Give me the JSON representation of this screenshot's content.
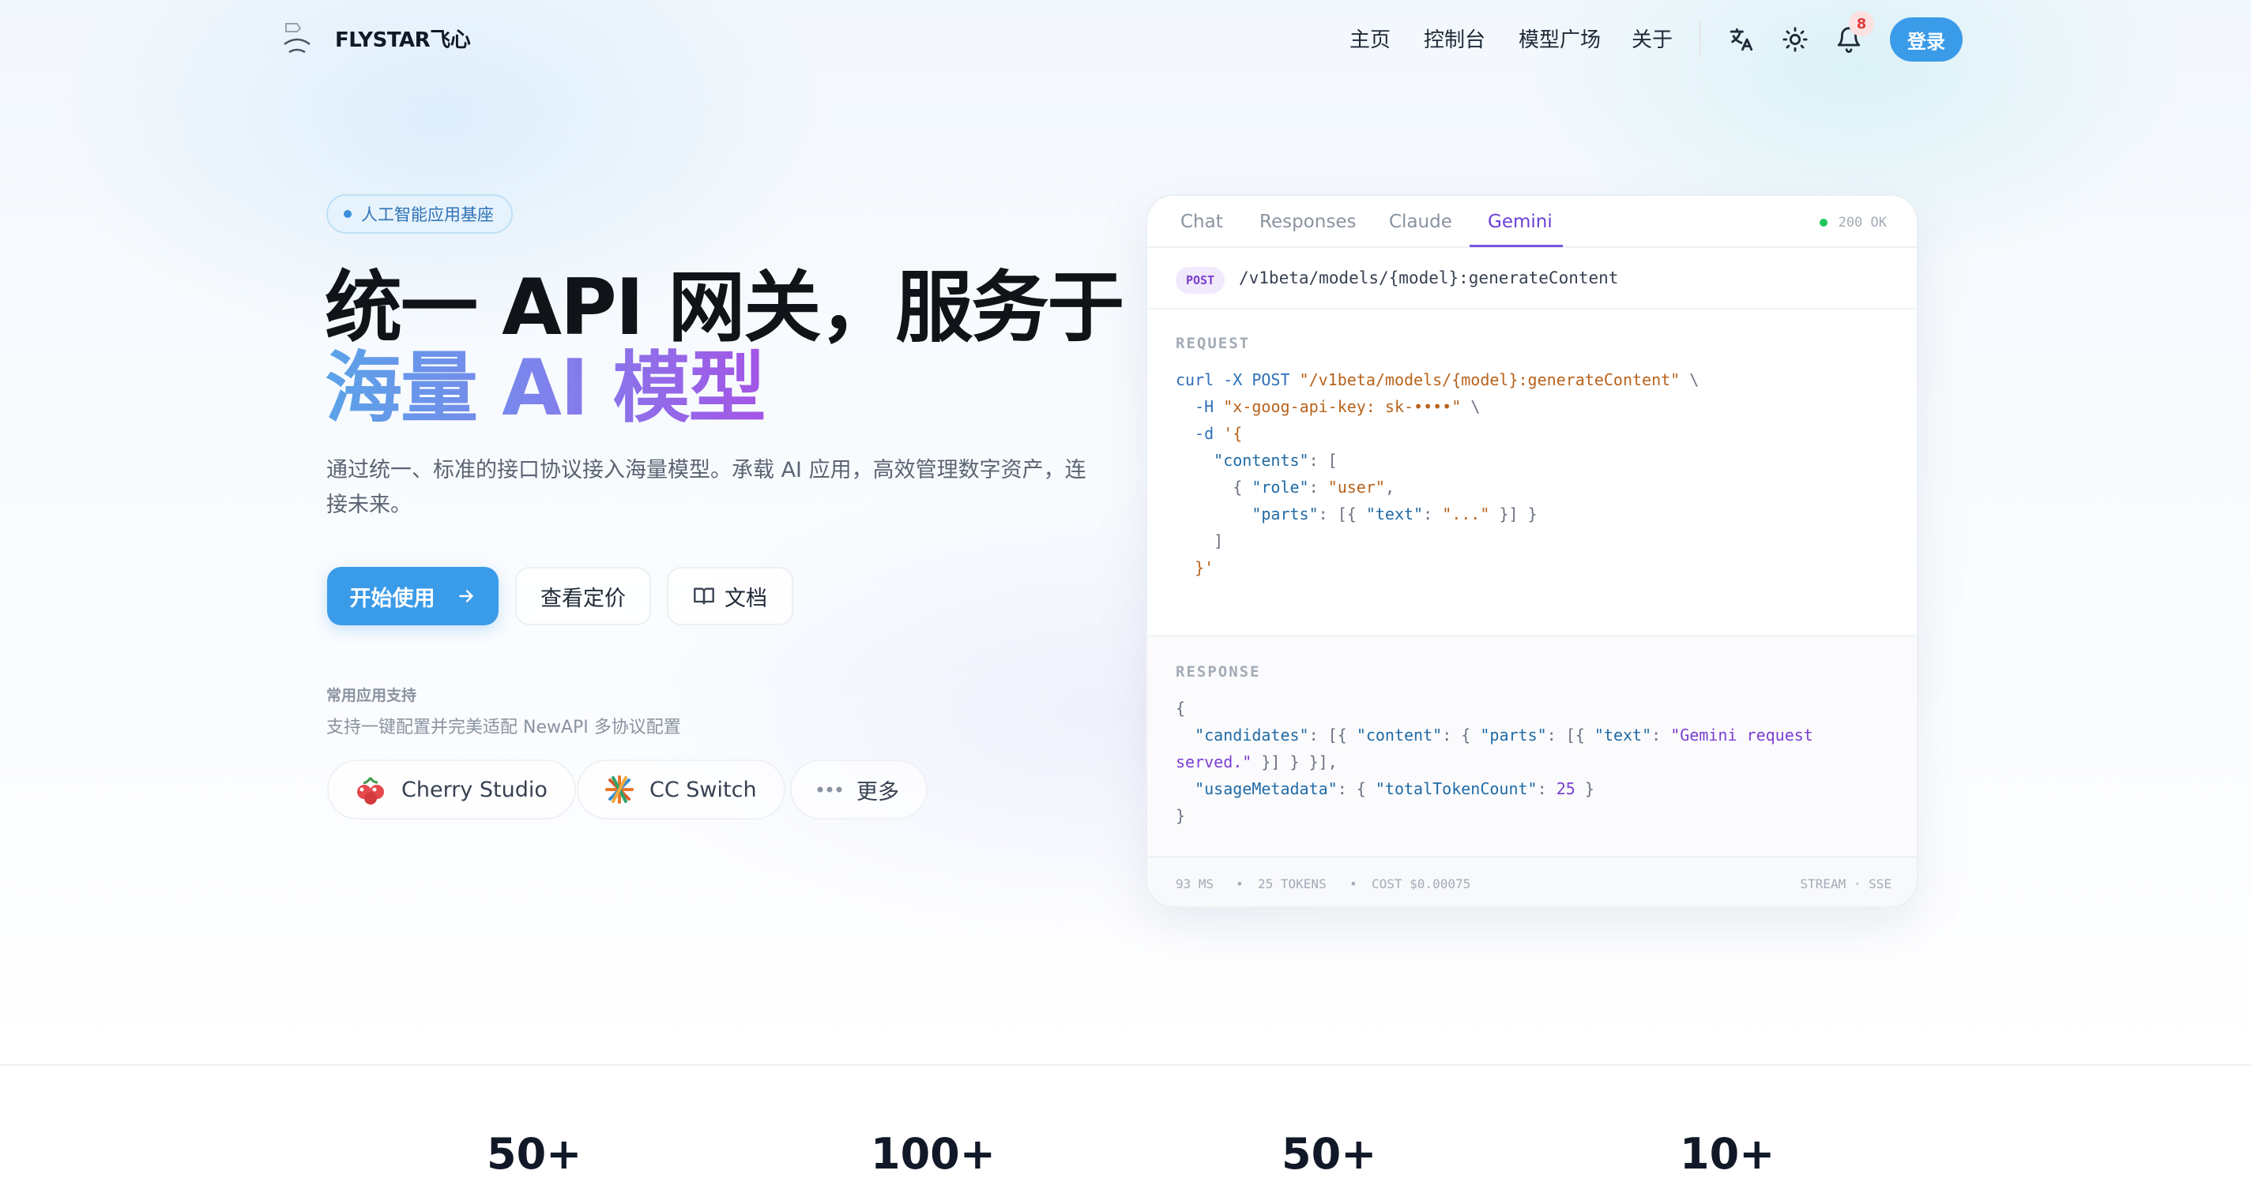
{
  "nav": {
    "brand": "FLYSTAR飞心",
    "links": [
      "主页",
      "控制台",
      "模型广场",
      "关于"
    ],
    "notification_count": "8",
    "login_label": "登录",
    "icons": [
      "translate-icon",
      "sun-icon",
      "bell-icon"
    ]
  },
  "hero": {
    "tag": "人工智能应用基座",
    "title_line1": "统一 API 网关，服务于",
    "title_line2": "海量 AI 模型",
    "subtitle": "通过统一、标准的接口协议接入海量模型。承载 AI 应用，高效管理数字资产，连接未来。",
    "primary_button": "开始使用",
    "pricing_button": "查看定价",
    "docs_button": "文档",
    "support_title": "常用应用支持",
    "support_subtitle": "支持一键配置并完美适配 NewAPI 多协议配置",
    "apps": [
      "Cherry Studio",
      "CC Switch",
      "更多"
    ]
  },
  "code_card": {
    "tabs": [
      "Chat",
      "Responses",
      "Claude",
      "Gemini"
    ],
    "active_tab": "Gemini",
    "status": "200 OK",
    "method": "POST",
    "endpoint": "/v1beta/models/{model}:generateContent",
    "request_label": "REQUEST",
    "response_label": "RESPONSE",
    "footer": {
      "latency": "93 MS",
      "tokens": "25 TOKENS",
      "cost": "COST $0.00075",
      "mode": "STREAM · SSE"
    },
    "colors": {
      "accent": "#7b55e0",
      "status_ok": "#22c55e"
    }
  },
  "stats": [
    "50+",
    "100+",
    "50+",
    "10+"
  ],
  "colors": {
    "primary": "#3a9be9",
    "gradient_start": "#5aa3e8",
    "gradient_end": "#a455e6"
  }
}
